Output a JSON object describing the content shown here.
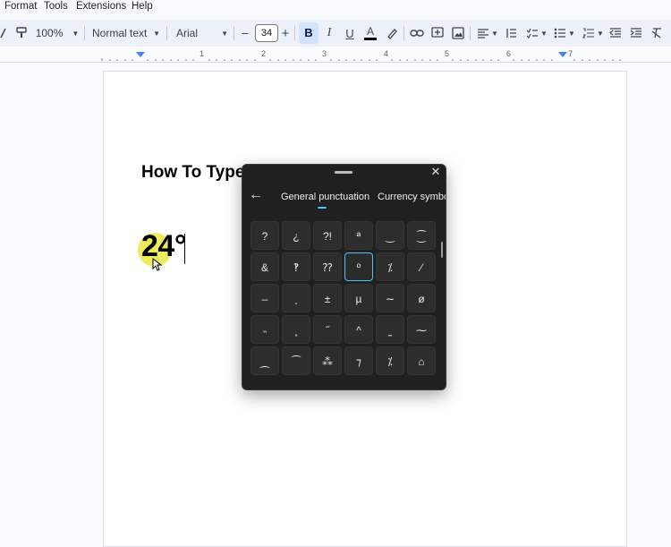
{
  "menu": [
    "Format",
    "Tools",
    "Extensions",
    "Help"
  ],
  "toolbar": {
    "zoom": "100%",
    "style": "Normal text",
    "font": "Arial",
    "font_size": "34",
    "bold": "B",
    "italic": "I",
    "underline": "U",
    "text_color_letter": "A",
    "decrease": "−",
    "increase": "+"
  },
  "ruler": [
    "1",
    "2",
    "3",
    "4",
    "5",
    "6",
    "7"
  ],
  "document": {
    "title": "How To Type",
    "content": "24°"
  },
  "symbol_panel": {
    "back": "←",
    "close": "✕",
    "tabs": [
      "General punctuation",
      "Currency symbol"
    ],
    "symbols": [
      [
        "?",
        "¿",
        "?!",
        "ª",
        "‿",
        "⁐"
      ],
      [
        "&",
        "‽",
        "⁇",
        "º",
        "⁒",
        "⁄"
      ],
      [
        "‒",
        "˯",
        "±",
        "µ",
        "∼",
        "ø"
      ],
      [
        "˵",
        "˳",
        "˝",
        "^",
        "˷",
        "⁓"
      ],
      [
        "⁔",
        "⁀",
        "⁂",
        "⁊",
        "⁒",
        "⌂"
      ]
    ],
    "selected_row": 1,
    "selected_col": 3
  },
  "colors": {
    "accent": "#4cc2ff",
    "toolbar_bg": "#edf2fa",
    "panel_bg": "#202020",
    "highlight": "#e6e628"
  }
}
